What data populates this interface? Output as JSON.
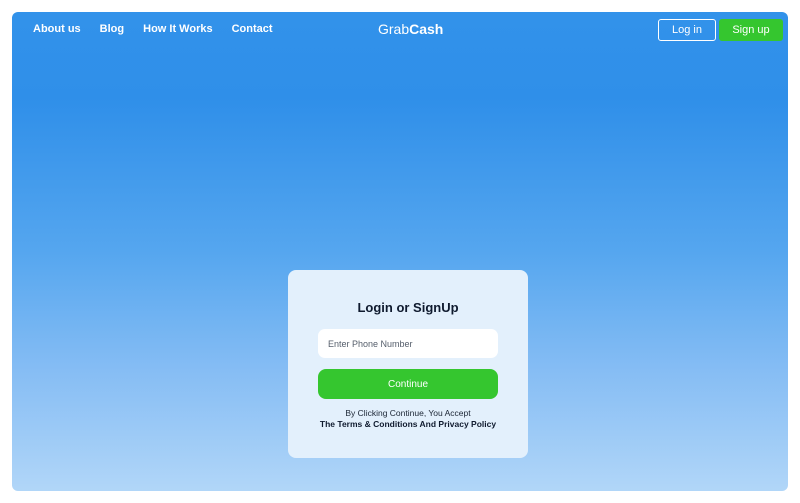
{
  "nav": {
    "links": [
      "About us",
      "Blog",
      "How It Works",
      "Contact"
    ],
    "login_label": "Log in",
    "signup_label": "Sign up"
  },
  "logo": {
    "part1": "Grab",
    "part2": "Cash"
  },
  "card": {
    "title": "Login or SignUp",
    "phone_placeholder": "Enter Phone Number",
    "continue_label": "Continue",
    "terms_text": "By Clicking Continue, You Accept",
    "terms_link": "The Terms & Conditions And Privacy Policy"
  },
  "colors": {
    "accent_green": "#35c62f",
    "background_blue_top": "#3292ea",
    "background_blue_bottom": "#b1d6f8",
    "card_background": "#e3f0fc"
  }
}
